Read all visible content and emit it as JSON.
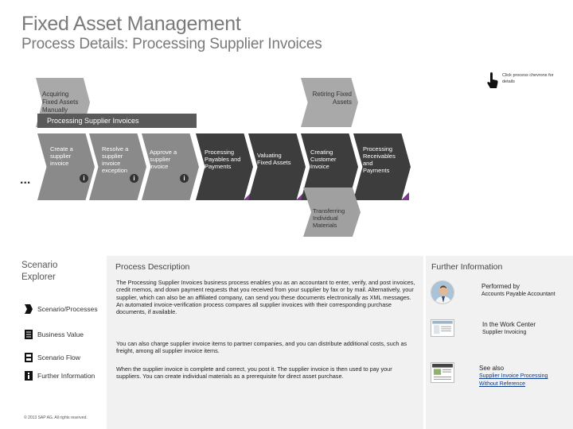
{
  "header": {
    "title": "Fixed Asset Management",
    "subtitle": "Process Details: Processing Supplier Invoices"
  },
  "hint": {
    "text": "Click process chevrons for details"
  },
  "top_steps": [
    {
      "label": "Acquiring Fixed Assets Manually"
    },
    {
      "label": "Retiring Fixed Assets"
    }
  ],
  "banner": {
    "label": "Processing Supplier Invoices",
    "close": "X"
  },
  "ellipsis": "...",
  "sub_steps": [
    {
      "label": "Create a supplier invoice"
    },
    {
      "label": "Resolve a supplier invoice exception"
    },
    {
      "label": "Approve a supplier invoice"
    }
  ],
  "main_steps": [
    {
      "label": "Processing Payables and Payments"
    },
    {
      "label": "Valuating Fixed Assets"
    },
    {
      "label": "Creating Customer Invoice"
    },
    {
      "label": "Processing Receivables and Payments"
    }
  ],
  "bottom_step": {
    "label": "Transferring Individual Materials"
  },
  "explorer": {
    "title": "Scenario Explorer",
    "items": [
      {
        "label": "Scenario/Processes",
        "icon": "process-icon"
      },
      {
        "label": "Business Value",
        "icon": "document-icon"
      },
      {
        "label": "Scenario Flow",
        "icon": "flow-icon"
      },
      {
        "label": "Further Information",
        "icon": "info-icon"
      }
    ],
    "copyright": "© 2013 SAP AG. All rights reserved."
  },
  "description": {
    "title": "Process Description",
    "p1": "The Processing Supplier Invoices business process enables you as an accountant to enter, verify, and post invoices, credit memos, and down payment requests that you received from your supplier by fax or by mail. Alternatively, your supplier, which can also be an affiliated company, can send you these documents electronically as XML messages. An automated invoice-verification process compares all supplier invoices with their corresponding purchase documents, if available.",
    "p2": "You can also charge supplier invoice items to partner companies, and you can distribute additional costs, such as freight, among all supplier invoice items.",
    "p3": "When the supplier invoice is complete and correct, you post it. The supplier invoice is then used to pay your suppliers. You can create individual materials as a prerequisite for direct asset purchase."
  },
  "further_info": {
    "title": "Further Information",
    "performed_by_label": "Performed by",
    "performed_by_value": "Accounts Payable Accountant",
    "work_center_label": "In the Work Center",
    "work_center_value": "Supplier Invoicing",
    "see_also_label": "See also",
    "see_also_link": "Supplier Invoice Processing Without Reference"
  },
  "colors": {
    "accent": "#7b3a8f",
    "chevron_dark": "#3d3d3d",
    "chevron": "#8a8a8a",
    "banner": "#5a5a5a"
  }
}
